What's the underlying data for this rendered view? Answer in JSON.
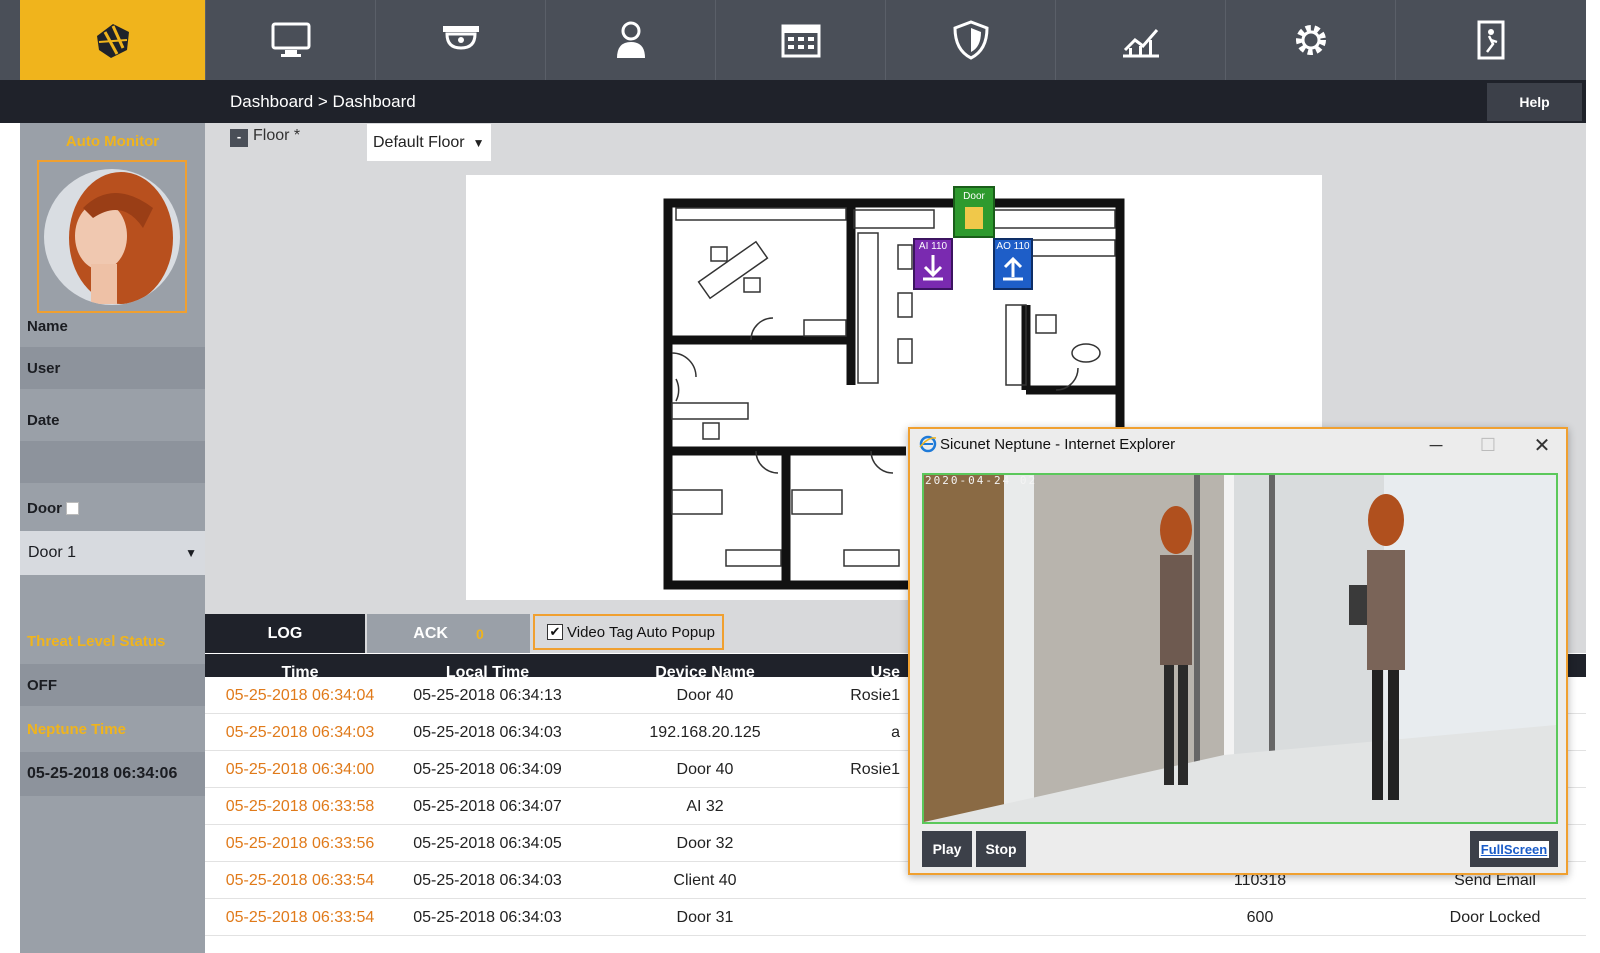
{
  "nav": {
    "items": [
      {
        "name": "monitor-icon"
      },
      {
        "name": "camera-icon"
      },
      {
        "name": "user-icon"
      },
      {
        "name": "calendar-icon"
      },
      {
        "name": "shield-icon"
      },
      {
        "name": "chart-icon"
      },
      {
        "name": "gear-icon"
      },
      {
        "name": "exit-icon"
      }
    ],
    "accent": "#f0b41c"
  },
  "breadcrumb": "Dashboard > Dashboard",
  "help_label": "Help",
  "left_panel": {
    "auto_monitor": "Auto Monitor",
    "name_label": "Name",
    "name_value": "User",
    "date_label": "Date",
    "date_value": "",
    "door_label": "Door",
    "door_select": "Door 1",
    "threat_label": "Threat Level Status",
    "threat_value": "OFF",
    "neptune_label": "Neptune Time",
    "neptune_value": "05-25-2018 06:34:06"
  },
  "floor": {
    "toggle": "-",
    "label": "Floor *",
    "selected": "Default Floor",
    "door_tag": "Door",
    "ai_tag": "AI 110",
    "ao_tag": "AO 110"
  },
  "tabs": {
    "log": "LOG",
    "ack": "ACK",
    "ack_count": "0",
    "video_tag": "Video Tag Auto Popup"
  },
  "table": {
    "headers": [
      "Time",
      "Local Time",
      "Device Name",
      "Use"
    ],
    "rows": [
      {
        "time": "05-25-2018 06:34:04",
        "local": "05-25-2018 06:34:13",
        "device": "Door 40",
        "user": "Rosie1",
        "c5": "",
        "c6": ""
      },
      {
        "time": "05-25-2018 06:34:03",
        "local": "05-25-2018 06:34:03",
        "device": "192.168.20.125",
        "user": "a",
        "c5": "",
        "c6": ""
      },
      {
        "time": "05-25-2018 06:34:00",
        "local": "05-25-2018 06:34:09",
        "device": "Door 40",
        "user": "Rosie1",
        "c5": "",
        "c6": ""
      },
      {
        "time": "05-25-2018 06:33:58",
        "local": "05-25-2018 06:34:07",
        "device": "AI 32",
        "user": "",
        "c5": "",
        "c6": ""
      },
      {
        "time": "05-25-2018 06:33:56",
        "local": "05-25-2018 06:34:05",
        "device": "Door 32",
        "user": "",
        "c5": "",
        "c6": ""
      },
      {
        "time": "05-25-2018 06:33:54",
        "local": "05-25-2018 06:34:03",
        "device": "Client 40",
        "user": "",
        "c5": "110318",
        "c6": "Send Email"
      },
      {
        "time": "05-25-2018 06:33:54",
        "local": "05-25-2018 06:34:03",
        "device": "Door 31",
        "user": "",
        "c5": "600",
        "c6": "Door Locked"
      }
    ]
  },
  "popup": {
    "title": "Sicunet Neptune - Internet Explorer",
    "timestamp": "2020-04-24 02",
    "play": "Play",
    "stop": "Stop",
    "fullscreen": "FullScreen"
  }
}
